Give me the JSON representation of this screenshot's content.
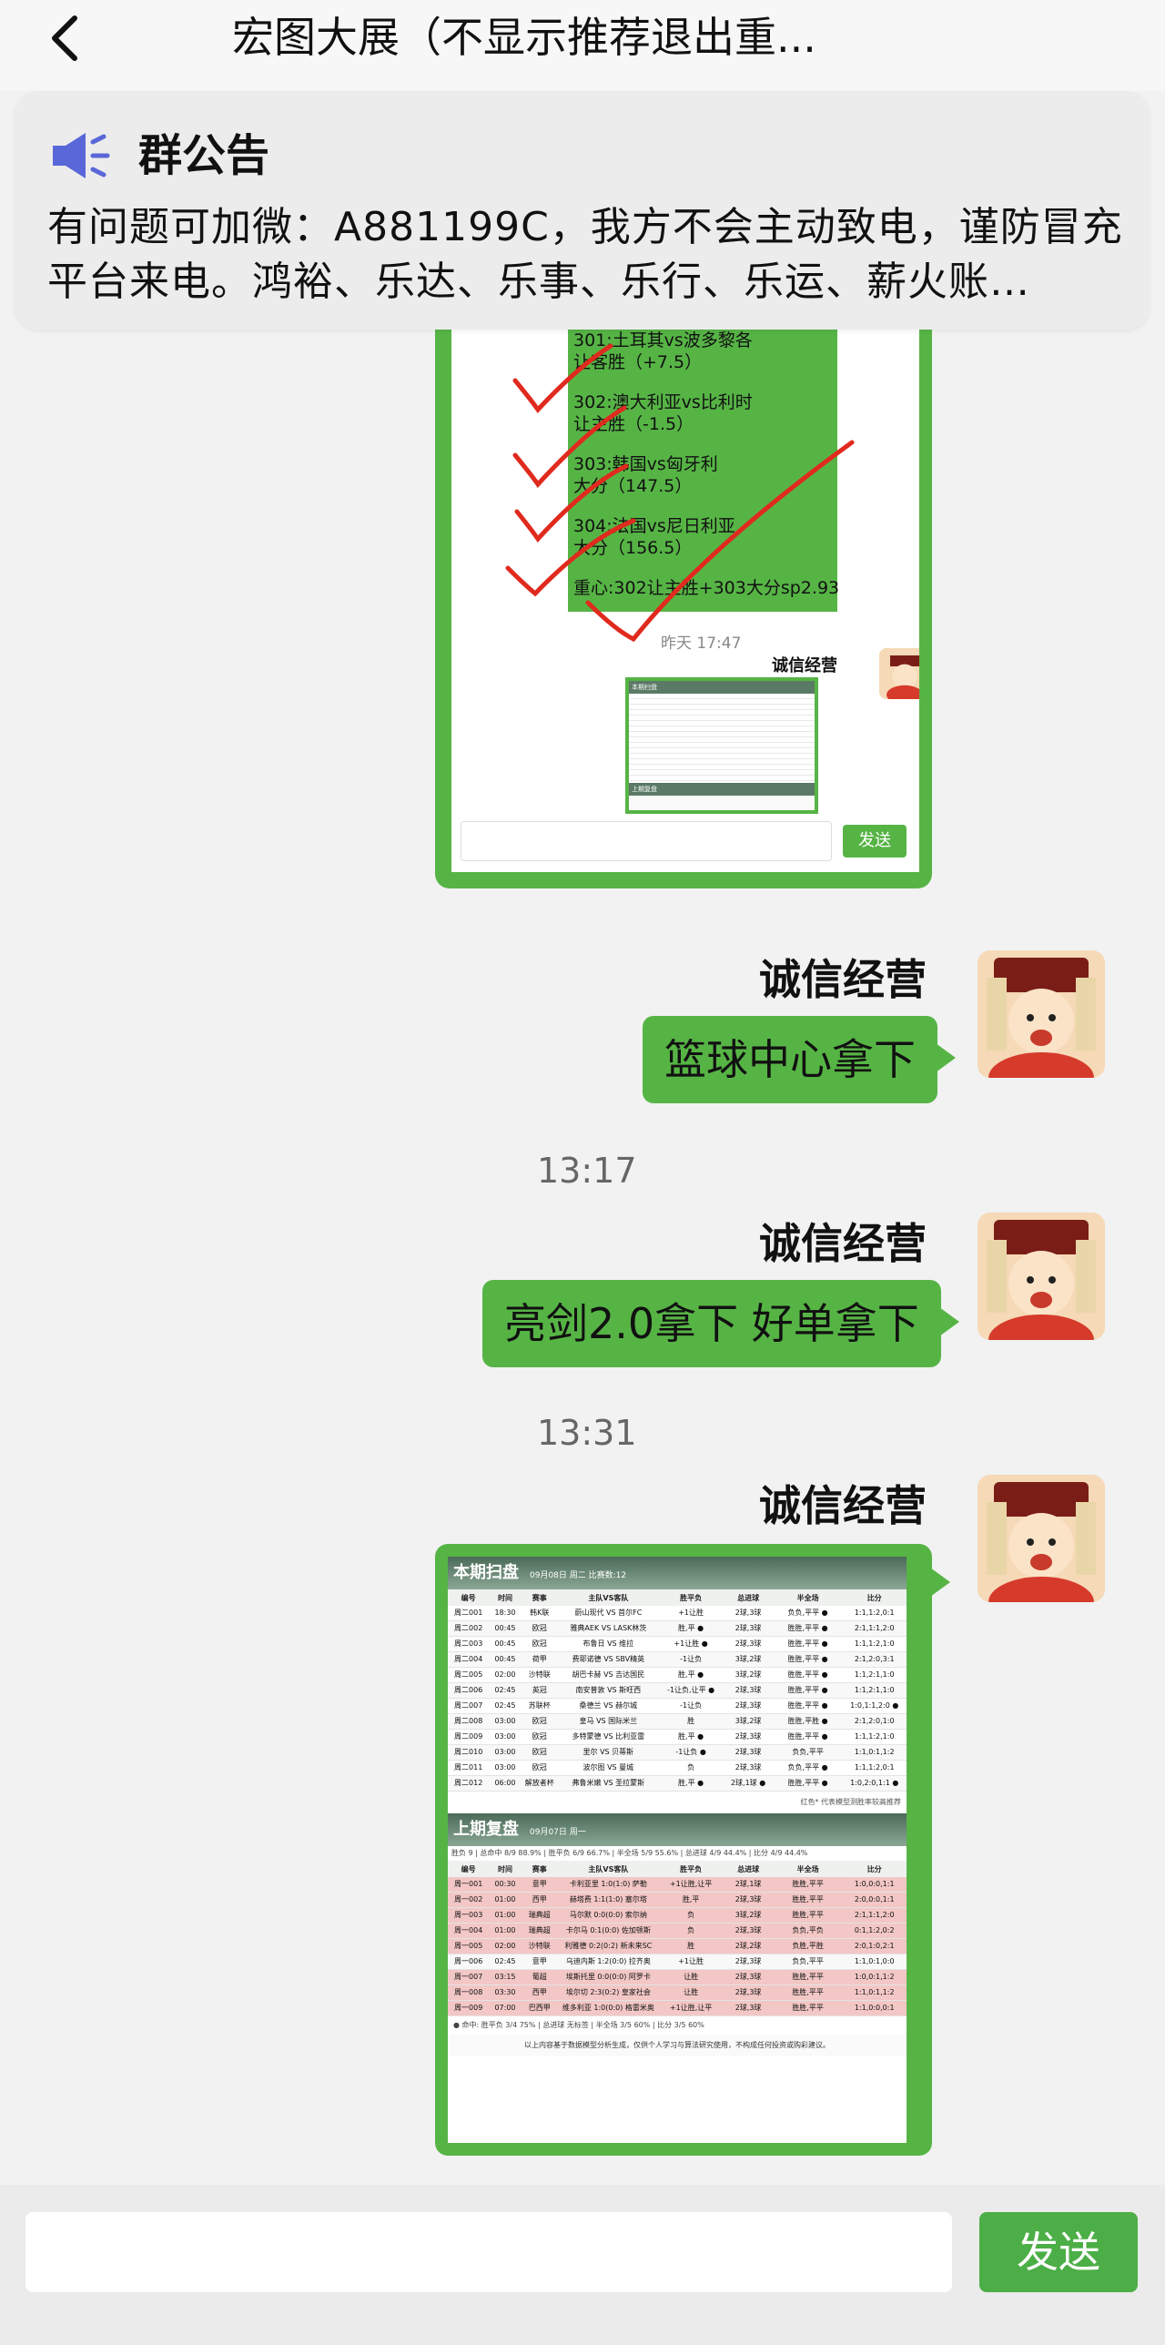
{
  "header": {
    "title": "宏图大展（不显示推荐退出重..."
  },
  "announcement": {
    "title": "群公告",
    "text": "有问题可加微：A881199C，我方不会主动致电，谨防冒充平台来电。鸿裕、乐达、乐事、乐行、乐运、薪火账…"
  },
  "screenshot1": {
    "lines": [
      "301:土耳其vs波多黎各",
      "让客胜（+7.5）",
      "302:澳大利亚vs比利时",
      "让主胜（-1.5）",
      "303:韩国vs匈牙利",
      "大分（147.5）",
      "304:法国vs尼日利亚",
      "大分（156.5）",
      "重心:302让主胜+303大分sp2.93"
    ],
    "time": "昨天 17:47",
    "sender": "诚信经营",
    "send_label": "发送",
    "thumb_title": "本期扫盘",
    "thumb_title2": "上期复盘"
  },
  "messages": [
    {
      "sender": "诚信经营",
      "text": "篮球中心拿下"
    },
    {
      "time": "13:17"
    },
    {
      "sender": "诚信经营",
      "text": "亮剑2.0拿下 好单拿下"
    },
    {
      "time": "13:31"
    },
    {
      "sender": "诚信经营"
    }
  ],
  "screenshot2": {
    "current": {
      "title": "本期扫盘",
      "subtitle": "09月08日 周二 比赛数:12",
      "headers": [
        "编号",
        "时间",
        "赛事",
        "主队VS客队",
        "胜平负",
        "总进球",
        "半全场",
        "比分"
      ],
      "rows": [
        [
          "周二001",
          "18:30",
          "韩K联",
          "蔚山现代 VS 首尔FC",
          "+1让胜",
          "2球,3球",
          "负负,平平 ●",
          "1:1,1:2,0:1"
        ],
        [
          "周二002",
          "00:45",
          "欧冠",
          "雅典AEK VS LASK林茨",
          "胜,平 ●",
          "2球,3球",
          "胜胜,平平 ●",
          "2:1,1:1,2:0"
        ],
        [
          "周二003",
          "00:45",
          "欧冠",
          "布鲁日 VS 维拉",
          "+1让胜 ●",
          "2球,3球",
          "胜胜,平平 ●",
          "1:1,1:2,1:0"
        ],
        [
          "周二004",
          "00:45",
          "荷甲",
          "费耶诺德 VS SBV精英",
          "-1让负",
          "3球,2球",
          "胜胜,平平 ●",
          "2:1,2:0,3:1"
        ],
        [
          "周二005",
          "02:00",
          "沙特联",
          "胡巴卡赫 VS 吉达国民",
          "胜,平 ●",
          "3球,2球",
          "胜胜,平平 ●",
          "1:1,2:1,1:0"
        ],
        [
          "周二006",
          "02:45",
          "英冠",
          "南安普敦 VS 斯旺西",
          "-1让负,让平 ●",
          "2球,3球",
          "胜胜,平平 ●",
          "1:1,2:1,1:0"
        ],
        [
          "周二007",
          "02:45",
          "苏联杯",
          "桑德兰 VS 赫尔城",
          "-1让负",
          "2球,3球",
          "胜胜,平平 ●",
          "1:0,1:1,2:0 ●"
        ],
        [
          "周二008",
          "03:00",
          "欧冠",
          "皇马 VS 国际米兰",
          "胜",
          "3球,2球",
          "胜胜,平胜 ●",
          "2:1,2:0,1:0"
        ],
        [
          "周二009",
          "03:00",
          "欧冠",
          "多特蒙德 VS 比利亚雷",
          "胜,平 ●",
          "2球,3球",
          "胜胜,平平 ●",
          "1:1,1:2,1:0"
        ],
        [
          "周二010",
          "03:00",
          "欧冠",
          "里尔 VS 贝蒂斯",
          "-1让负 ●",
          "2球,3球",
          "负负,平平",
          "1:1,0:1,1:2"
        ],
        [
          "周二011",
          "03:00",
          "欧冠",
          "波尔图 VS 曼城",
          "负",
          "2球,3球",
          "负负,平平 ●",
          "1:1,1:2,0:1"
        ],
        [
          "周二012",
          "06:00",
          "解放者杯",
          "弗鲁米嫩 VS 圣拉蒙斯",
          "胜,平 ●",
          "2球,1球 ●",
          "胜胜,平平 ●",
          "1:0,2:0,1:1 ●"
        ]
      ],
      "footnote": "红色* 代表模型测胜率较高推荐"
    },
    "previous": {
      "title": "上期复盘",
      "subtitle": "09月07日 周一",
      "summary": "胜负 9 | 总命中 8/9 88.9% | 胜平负 6/9 66.7% | 半全场 5/9 55.6% | 总进球 4/9 44.4% | 比分 4/9 44.4%",
      "headers": [
        "编号",
        "时间",
        "赛事",
        "主队VS客队",
        "胜平负",
        "总进球",
        "半全场",
        "比分"
      ],
      "rows": [
        [
          "周一001",
          "00:30",
          "意甲",
          "卡利亚里 1:0(1:0) 萨勒",
          "+1让胜,让平",
          "2球,1球",
          "胜胜,平平",
          "1:0,0:0,1:1"
        ],
        [
          "周一002",
          "01:00",
          "西甲",
          "赫塔费 1:1(1:0) 塞尔塔",
          "胜,平",
          "2球,3球",
          "胜胜,平平",
          "2:0,0:0,1:1"
        ],
        [
          "周一003",
          "01:00",
          "瑞典超",
          "马尔默 0:0(0:0) 索尔纳",
          "负",
          "3球,2球",
          "胜胜,平平",
          "2:1,1:1,2:0"
        ],
        [
          "周一004",
          "01:00",
          "瑞典超",
          "卡尔马 0:1(0:0) 佐加顿斯",
          "负",
          "2球,3球",
          "负负,平负",
          "0:1,1:2,0:2"
        ],
        [
          "周一005",
          "02:00",
          "沙特联",
          "利雅德 0:2(0:2) 新未来SC",
          "胜",
          "2球,2球",
          "负胜,平胜",
          "2:0,1:0,2:1"
        ],
        [
          "周一006",
          "02:45",
          "意甲",
          "乌迪内斯 1:2(0:0) 拉齐奥",
          "+1让胜",
          "2球,3球",
          "负负,平平",
          "1:1,0:1,0:0"
        ],
        [
          "周一007",
          "03:15",
          "葡超",
          "埃斯托里 0:0(0:0) 阿罗卡",
          "让胜",
          "2球,3球",
          "胜胜,平平",
          "1:0,0:1,1:2"
        ],
        [
          "周一008",
          "03:30",
          "西甲",
          "埃尔切 2:3(0:2) 皇家社会",
          "让胜",
          "2球,3球",
          "胜胜,平平",
          "1:1,0:1,1:2"
        ],
        [
          "周一009",
          "07:00",
          "巴西甲",
          "维多利亚 1:0(0:0) 格雷米奥",
          "+1让胜,让平",
          "2球,3球",
          "胜胜,平平",
          "1:1,0:0,0:1"
        ]
      ],
      "footer": "● 命中: 胜平负 3/4 75% | 总进球 无标签 | 半全场 3/5 60% | 比分 3/5 60%",
      "disclaimer": "以上内容基于数据模型分析生成，仅供个人学习与算法研究使用，不构成任何投资或购彩建议。"
    }
  },
  "input": {
    "send_label": "发送"
  },
  "colors": {
    "bubble": "#56b445",
    "send": "#4cae46",
    "background": "#f2f2f2"
  }
}
